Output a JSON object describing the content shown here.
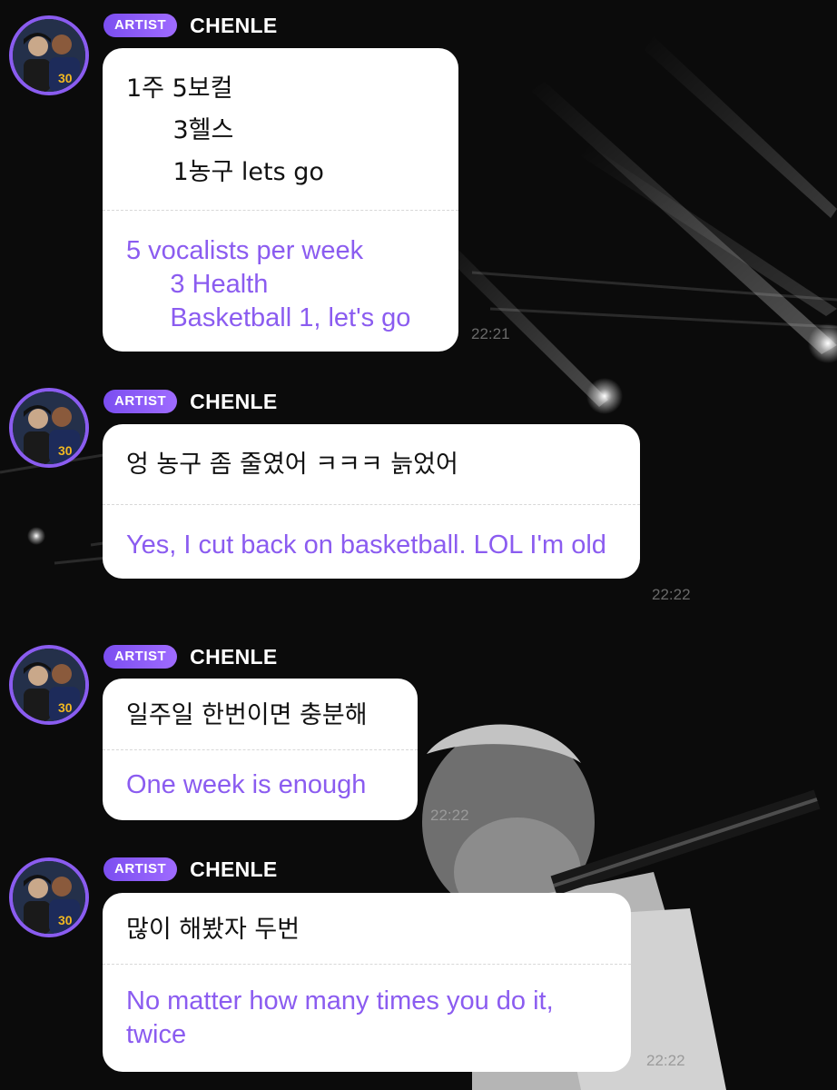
{
  "messages": [
    {
      "badge": "ARTIST",
      "name": "CHENLE",
      "original": "1주 5보컬\n      3헬스\n      1농구 lets go",
      "translation": "5 vocalists per week\n      3 Health\n      Basketball 1, let's go",
      "time": "22:21"
    },
    {
      "badge": "ARTIST",
      "name": "CHENLE",
      "original": "엉 농구 좀 줄였어 ㅋㅋㅋ 늙었어",
      "translation": "Yes, I cut back on basketball. LOL I'm old",
      "time": "22:22"
    },
    {
      "badge": "ARTIST",
      "name": "CHENLE",
      "original": "일주일 한번이면 충분해",
      "translation": "One week is enough",
      "time": "22:22"
    },
    {
      "badge": "ARTIST",
      "name": "CHENLE",
      "original": "많이 해봤자 두번",
      "translation": "No matter how many times you do it, twice",
      "time": "22:22"
    }
  ],
  "colors": {
    "accent": "#8b5cf0",
    "badge_gradient": [
      "#7b4ef0",
      "#9f6bff"
    ],
    "bubble": "#ffffff",
    "background": "#0b0b0b"
  },
  "icons": {
    "avatar": "profile-photo-avatar"
  }
}
